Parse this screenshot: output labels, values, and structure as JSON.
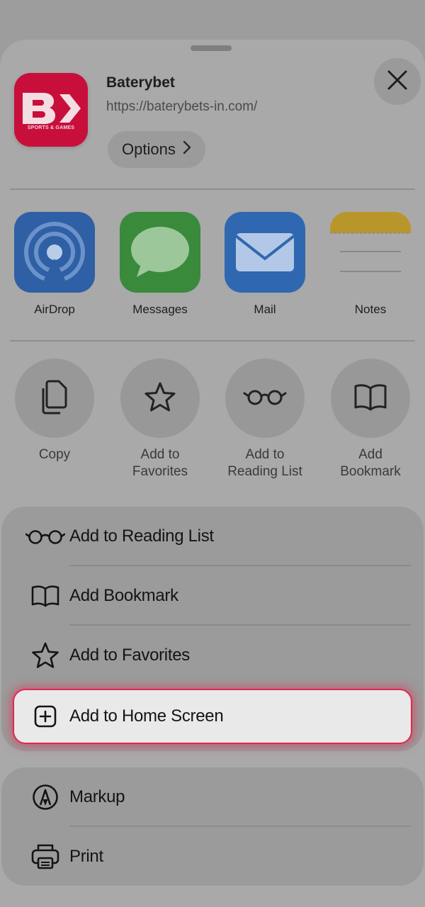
{
  "app": {
    "name": "Baterybet",
    "url": "https://baterybets-in.com/",
    "icon_caption": "SPORTS & GAMES",
    "brand_color": "#c80f3c",
    "options_label": "Options"
  },
  "share_apps": [
    {
      "label": "AirDrop",
      "icon": "airdrop-icon"
    },
    {
      "label": "Messages",
      "icon": "messages-icon"
    },
    {
      "label": "Mail",
      "icon": "mail-icon"
    },
    {
      "label": "Notes",
      "icon": "notes-icon"
    }
  ],
  "actions": [
    {
      "label": "Copy",
      "icon": "copy-icon"
    },
    {
      "label": "Add to Favorites",
      "icon": "star-icon"
    },
    {
      "label": "Add to Reading List",
      "icon": "glasses-icon"
    },
    {
      "label": "Add Bookmark",
      "icon": "book-icon"
    }
  ],
  "menu": {
    "reading_list": "Add to Reading List",
    "bookmark": "Add Bookmark",
    "favorites": "Add to Favorites",
    "home_screen": "Add to Home Screen",
    "markup": "Markup",
    "print": "Print"
  },
  "highlight_color": "#e0294f"
}
